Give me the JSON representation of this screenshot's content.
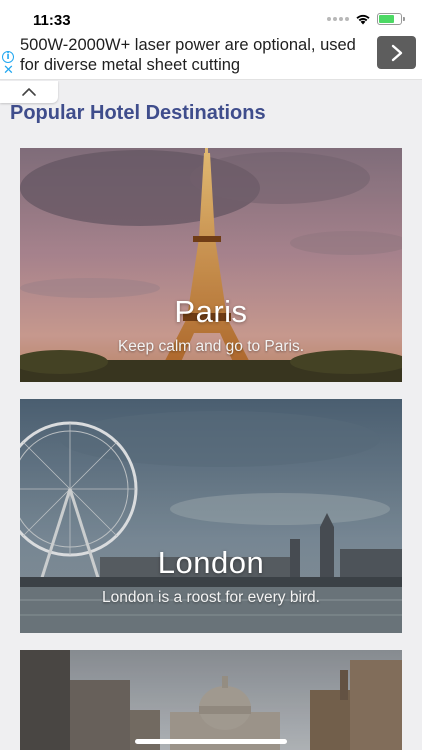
{
  "status_bar": {
    "time": "11:33"
  },
  "ad": {
    "text": "500W-2000W+ laser power are optional, used for diverse metal sheet cutting",
    "info_glyph": "i",
    "close_glyph": "✕"
  },
  "section_title": "Popular Hotel Destinations",
  "destinations": [
    {
      "name": "Paris",
      "tagline": "Keep calm and go to Paris."
    },
    {
      "name": "London",
      "tagline": "London is a roost for every bird."
    },
    {
      "name": "",
      "tagline": ""
    }
  ],
  "colors": {
    "title": "#3f4d8c",
    "ad_info": "#22a7f0",
    "battery": "#4cd964"
  },
  "icons": [
    "signal-icon",
    "wifi-icon",
    "battery-icon",
    "ad-info-icon",
    "ad-close-icon",
    "chevron-right-icon",
    "chevron-up-icon"
  ]
}
